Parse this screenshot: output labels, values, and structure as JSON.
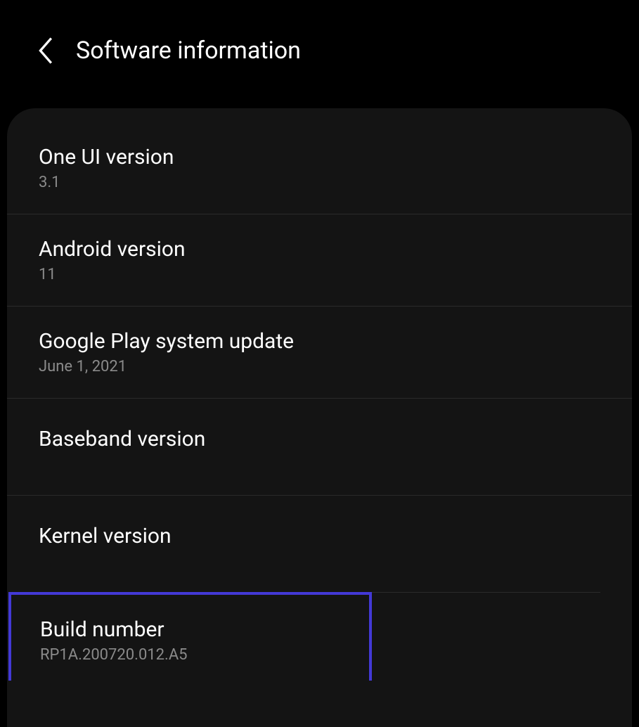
{
  "header": {
    "title": "Software information"
  },
  "items": [
    {
      "title": "One UI version",
      "value": "3.1"
    },
    {
      "title": "Android version",
      "value": "11"
    },
    {
      "title": "Google Play system update",
      "value": "June 1, 2021"
    },
    {
      "title": "Baseband version",
      "value": ""
    },
    {
      "title": "Kernel version",
      "value": ""
    },
    {
      "title": "Build number",
      "value": "RP1A.200720.012.A5"
    }
  ]
}
